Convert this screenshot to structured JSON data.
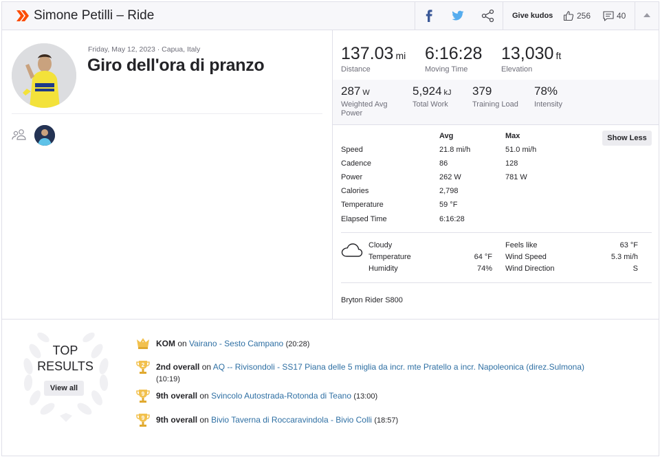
{
  "header": {
    "title": "Simone Petilli – Ride",
    "give_kudos": "Give kudos",
    "kudos_count": "256",
    "comment_count": "40",
    "brand_color": "#fc4c02"
  },
  "activity": {
    "meta": "Friday, May 12, 2023 · Capua, Italy",
    "title": "Giro dell'ora di pranzo"
  },
  "stats_primary": [
    {
      "value": "137.03",
      "unit": "mi",
      "label": "Distance"
    },
    {
      "value": "6:16:28",
      "unit": "",
      "label": "Moving Time"
    },
    {
      "value": "13,030",
      "unit": "ft",
      "label": "Elevation"
    }
  ],
  "stats_secondary": [
    {
      "value": "287",
      "unit": "W",
      "label": "Weighted Avg Power"
    },
    {
      "value": "5,924",
      "unit": "kJ",
      "label": "Total Work"
    },
    {
      "value": "379",
      "unit": "",
      "label": "Training Load"
    },
    {
      "value": "78%",
      "unit": "",
      "label": "Intensity"
    }
  ],
  "table": {
    "avg_header": "Avg",
    "max_header": "Max",
    "show_less": "Show Less",
    "rows": [
      {
        "label": "Speed",
        "avg": "21.8 mi/h",
        "max": "51.0 mi/h"
      },
      {
        "label": "Cadence",
        "avg": "86",
        "max": "128"
      },
      {
        "label": "Power",
        "avg": "262 W",
        "max": "781 W"
      },
      {
        "label": "Calories",
        "avg": "2,798",
        "max": ""
      },
      {
        "label": "Temperature",
        "avg": "59 °F",
        "max": ""
      },
      {
        "label": "Elapsed Time",
        "avg": "6:16:28",
        "max": ""
      }
    ]
  },
  "weather": {
    "condition": "Cloudy",
    "temperature_label": "Temperature",
    "temperature": "64 °F",
    "humidity_label": "Humidity",
    "humidity": "74%",
    "feels_like_label": "Feels like",
    "feels_like": "63 °F",
    "wind_speed_label": "Wind Speed",
    "wind_speed": "5.3 mi/h",
    "wind_direction_label": "Wind Direction",
    "wind_direction": "S"
  },
  "device": "Bryton Rider S800",
  "top_results": {
    "title_line1": "TOP",
    "title_line2": "RESULTS",
    "view_all": "View all",
    "items": [
      {
        "rank": "KOM",
        "on": "on",
        "segment": "Vairano - Sesto Campano",
        "time": "(20:28)",
        "icon": "crown-icon"
      },
      {
        "rank": "2nd overall",
        "on": "on",
        "segment": "AQ -- Rivisondoli - SS17 Piana delle 5 miglia da incr. mte Pratello a incr. Napoleonica (direz.Sulmona)",
        "time": "(10:19)",
        "icon": "trophy-icon",
        "badge": "2"
      },
      {
        "rank": "9th overall",
        "on": "on",
        "segment": "Svincolo Autostrada-Rotonda di Teano",
        "time": "(13:00)",
        "icon": "trophy-icon",
        "badge": "9"
      },
      {
        "rank": "9th overall",
        "on": "on",
        "segment": "Bivio Taverna di Roccaravindola - Bivio Colli",
        "time": "(18:57)",
        "icon": "trophy-icon",
        "badge": "9"
      }
    ]
  }
}
